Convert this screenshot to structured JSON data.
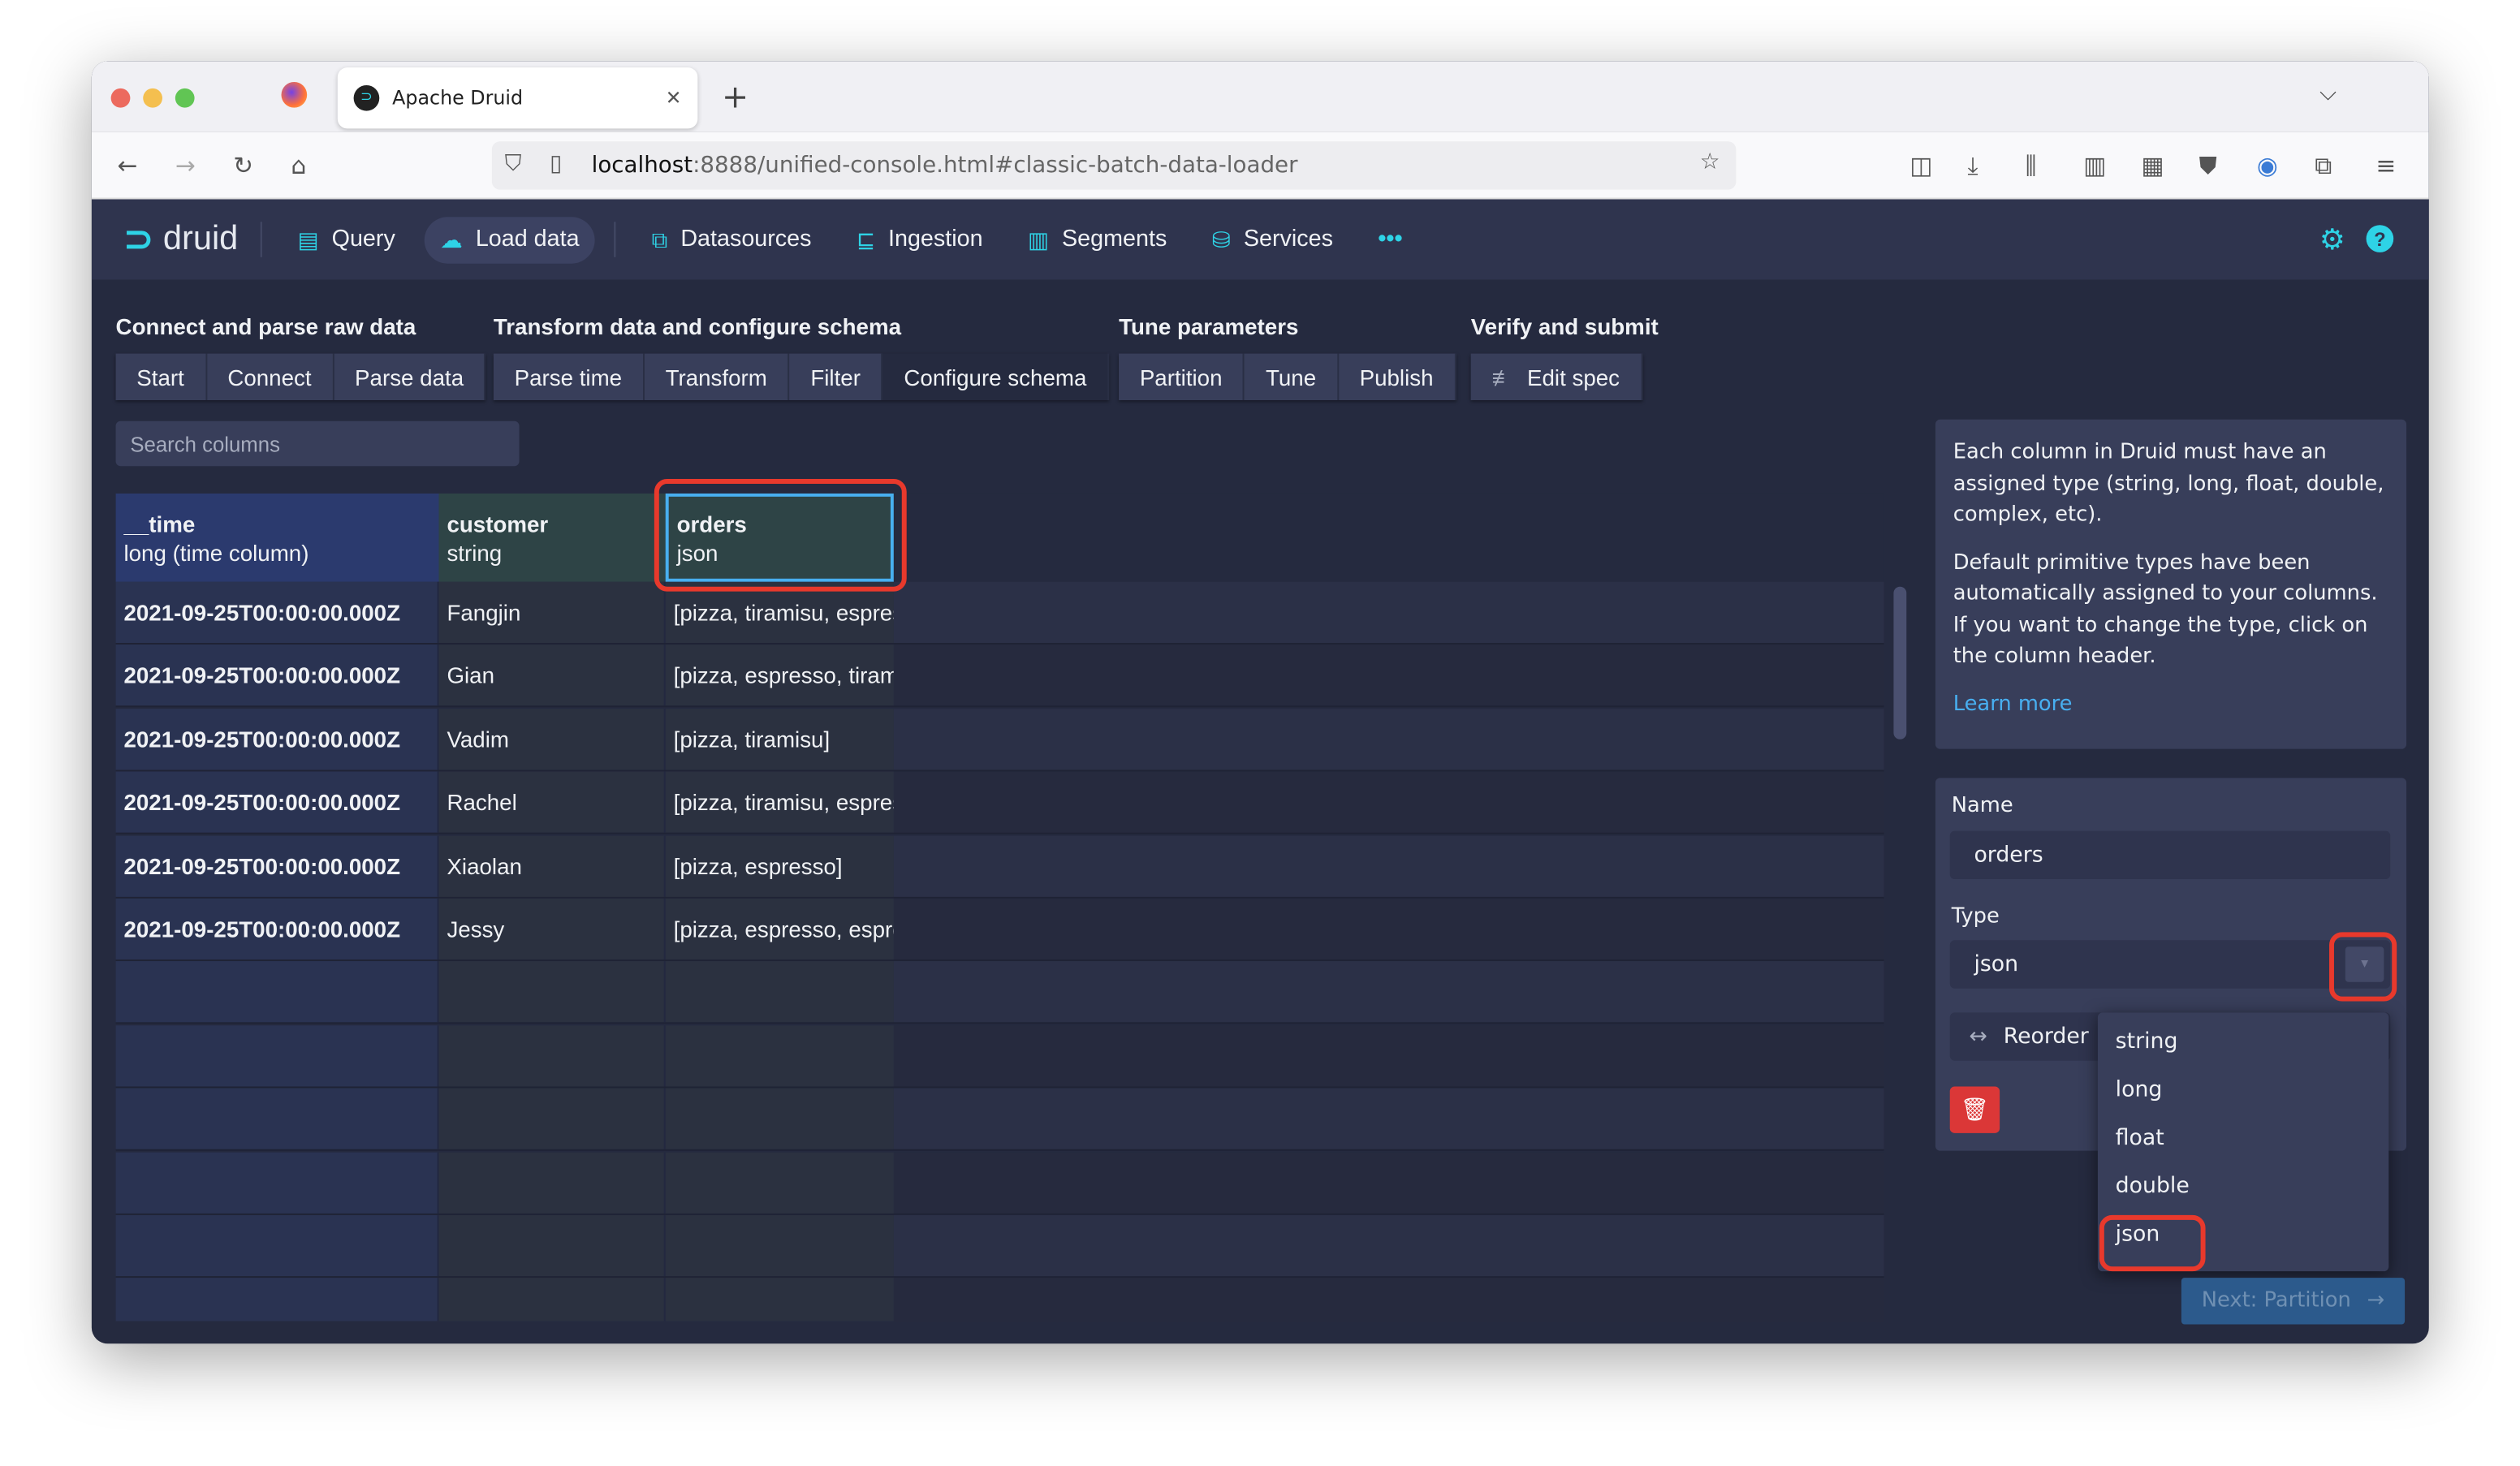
{
  "browser": {
    "tab_title": "Apache Druid",
    "url_host": "localhost",
    "url_rest": ":8888/unified-console.html#classic-batch-data-loader"
  },
  "header": {
    "logo": "druid",
    "nav": [
      {
        "label": "Query",
        "icon": "query-icon"
      },
      {
        "label": "Load data",
        "icon": "upload-icon",
        "active": true
      },
      {
        "label": "Datasources",
        "icon": "datasources-icon"
      },
      {
        "label": "Ingestion",
        "icon": "ingestion-icon"
      },
      {
        "label": "Segments",
        "icon": "segments-icon"
      },
      {
        "label": "Services",
        "icon": "database-icon"
      }
    ],
    "more": "•••"
  },
  "steps": {
    "groups": [
      {
        "label": "Connect and parse raw data",
        "steps": [
          "Start",
          "Connect",
          "Parse data"
        ]
      },
      {
        "label": "Transform data and configure schema",
        "steps": [
          "Parse time",
          "Transform",
          "Filter",
          "Configure schema"
        ]
      },
      {
        "label": "Tune parameters",
        "steps": [
          "Partition",
          "Tune",
          "Publish"
        ]
      },
      {
        "label": "Verify and submit",
        "steps": [
          "Edit spec"
        ]
      }
    ],
    "current": "Configure schema"
  },
  "search": {
    "placeholder": "Search columns"
  },
  "table": {
    "columns": [
      {
        "name": "__time",
        "type": "long (time column)"
      },
      {
        "name": "customer",
        "type": "string"
      },
      {
        "name": "orders",
        "type": "json"
      }
    ],
    "rows": [
      [
        "2021-09-25T00:00:00.000Z",
        "Fangjin",
        "[pizza, tiramisu, espresso]"
      ],
      [
        "2021-09-25T00:00:00.000Z",
        "Gian",
        "[pizza, espresso, tiramisu]"
      ],
      [
        "2021-09-25T00:00:00.000Z",
        "Vadim",
        "[pizza, tiramisu]"
      ],
      [
        "2021-09-25T00:00:00.000Z",
        "Rachel",
        "[pizza, tiramisu, espresso]"
      ],
      [
        "2021-09-25T00:00:00.000Z",
        "Xiaolan",
        "[pizza, espresso]"
      ],
      [
        "2021-09-25T00:00:00.000Z",
        "Jessy",
        "[pizza, espresso, espresso]"
      ]
    ]
  },
  "info": {
    "p1": "Each column in Druid must have an assigned type (string, long, float, double, complex, etc).",
    "p2": "Default primitive types have been automatically assigned to your columns. If you want to change the type, click on the column header.",
    "link": "Learn more"
  },
  "form": {
    "name_label": "Name",
    "name_value": "orders",
    "type_label": "Type",
    "type_value": "json",
    "reorder": "Reorder"
  },
  "type_menu": {
    "options": [
      "string",
      "long",
      "float",
      "double",
      "json"
    ],
    "highlighted": "json"
  },
  "next_button": "Next: Partition",
  "colors": {
    "accent": "#2ed3e6",
    "highlight": "#e8392c",
    "delete": "#db3737"
  }
}
